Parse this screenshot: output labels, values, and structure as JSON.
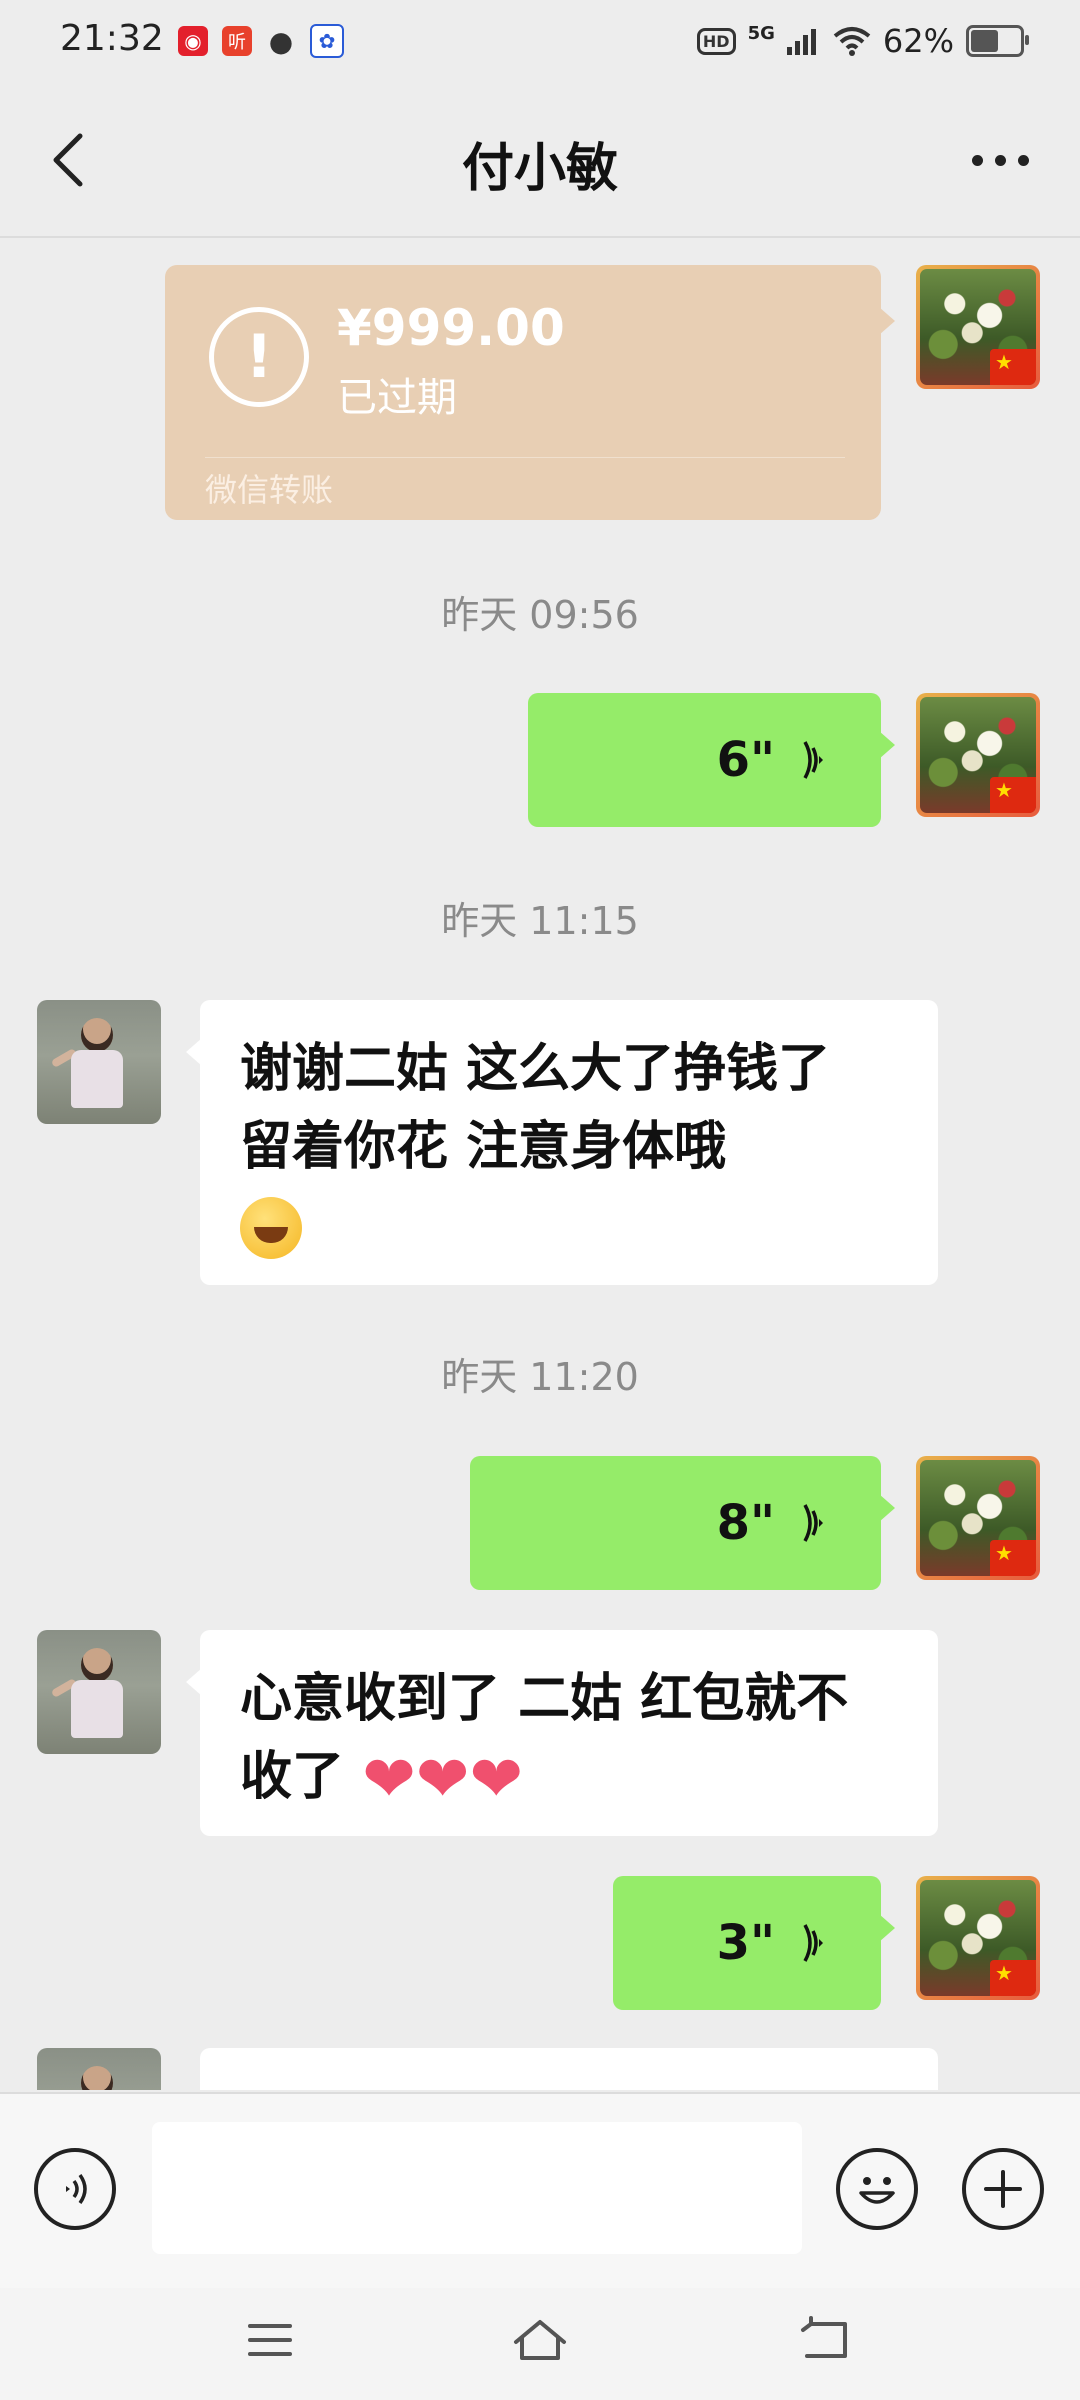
{
  "status_bar": {
    "time": "21:32",
    "app_icons": [
      "netease-music-icon",
      "listen-app-icon",
      "chat-bubble-icon",
      "baidu-icon"
    ],
    "hd_label": "HD",
    "network": "5G",
    "battery": "62%",
    "battery_level": 0.62
  },
  "nav": {
    "title": "付小敏",
    "back_icon": "chevron-left-icon",
    "more_icon": "more-dots-icon"
  },
  "messages": {
    "transfer": {
      "amount": "¥999.00",
      "status": "已过期",
      "label": "微信转账"
    },
    "time1": "昨天 09:56",
    "voice1": "6\"",
    "time2": "昨天 11:15",
    "text1": "谢谢二姑  这么大了挣钱了 留着你花 注意身体哦",
    "text1_emoji": "hugging-face-emoji",
    "time3": "昨天 11:20",
    "voice2": "8\"",
    "text2": "心意收到了 二姑 红包就不收了 ",
    "text2_hearts": "❤❤❤",
    "voice3": "3\""
  },
  "input_bar": {
    "voice_icon": "voice-input-icon",
    "text_value": "",
    "emoji_icon": "emoji-icon",
    "plus_icon": "plus-icon"
  },
  "system_nav": {
    "menu_icon": "menu-icon",
    "home_icon": "home-icon",
    "back_icon": "back-icon"
  },
  "colors": {
    "background": "#ededed",
    "green_bubble": "#95ec69",
    "transfer_card": "#e8cfb4"
  }
}
